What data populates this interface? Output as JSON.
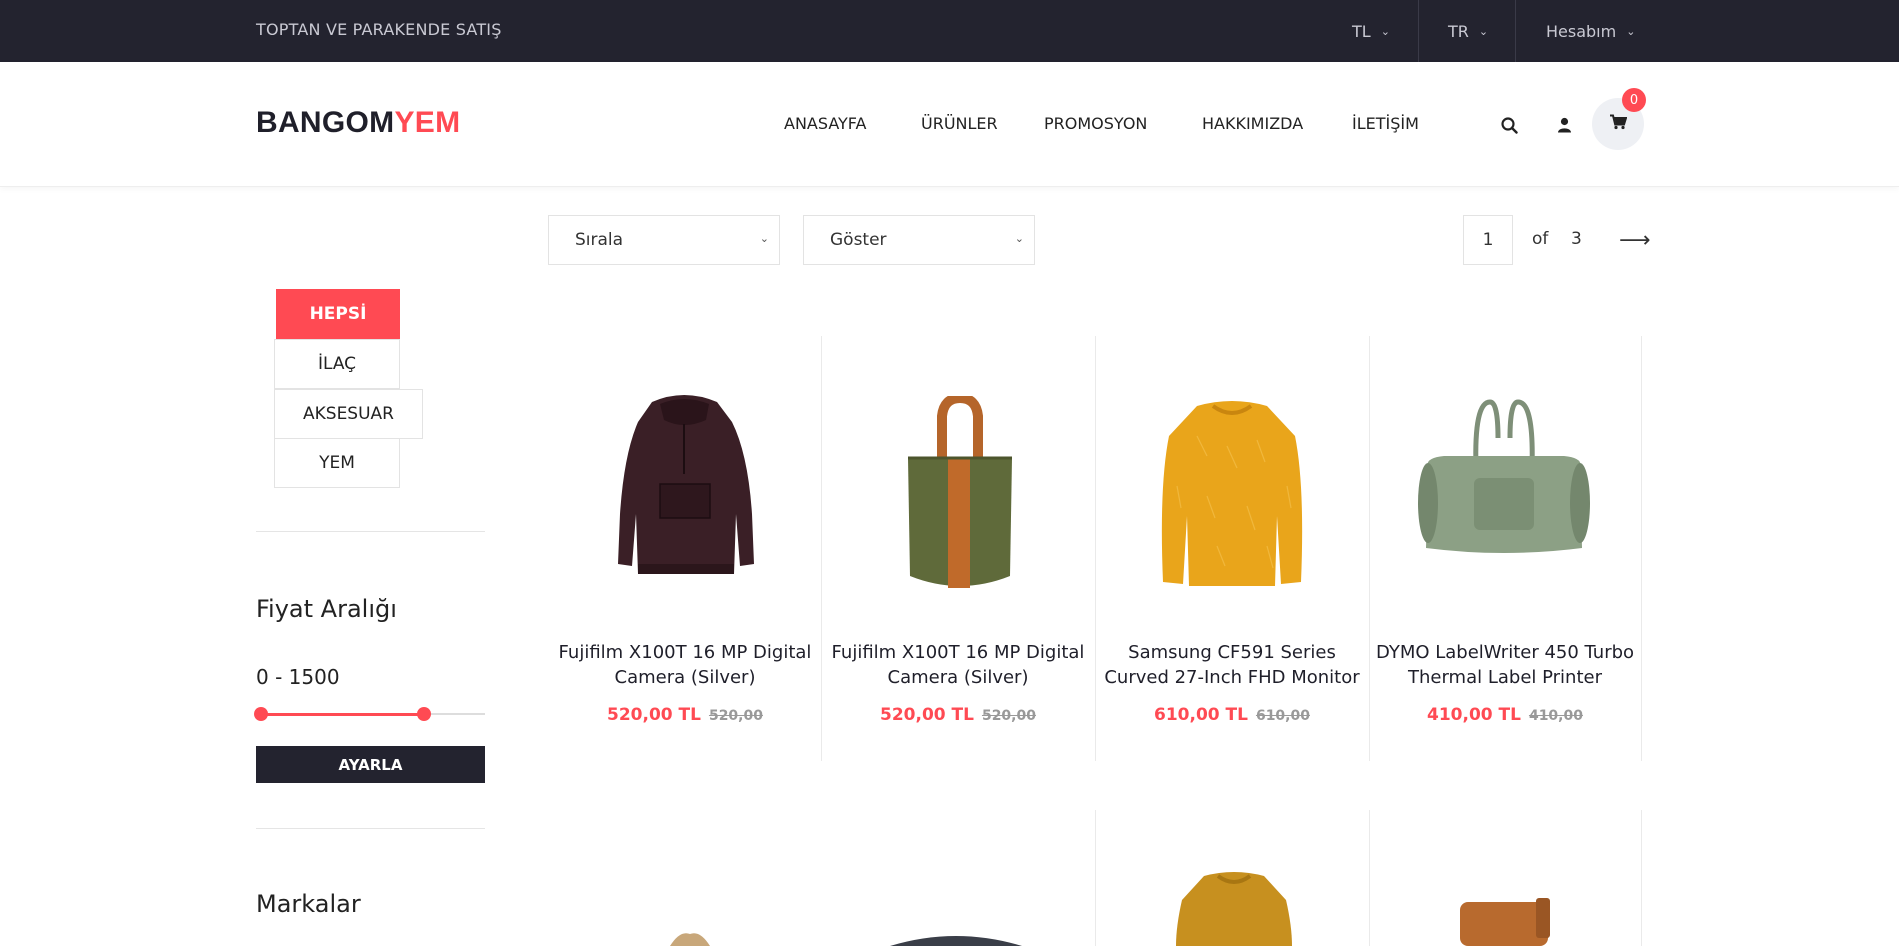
{
  "topbar": {
    "slogan": "TOPTAN VE PARAKENDE SATIŞ",
    "currency": "TL",
    "language": "TR",
    "account": "Hesabım"
  },
  "logo": {
    "part1": "BANGOM",
    "part2": "YEM"
  },
  "nav": [
    "ANASAYFA",
    "ÜRÜNLER",
    "PROMOSYON",
    "HAKKIMIZDA",
    "İLETİŞİM"
  ],
  "cart": {
    "count": "0"
  },
  "toolbar": {
    "sort_label": "Sırala",
    "show_label": "Göster",
    "page_current": "1",
    "page_of": "of",
    "page_total": "3"
  },
  "categories": [
    "HEPSİ",
    "İLAÇ",
    "AKSESUAR",
    "YEM"
  ],
  "price_filter": {
    "title": "Fiyat Aralığı",
    "range": "0 - 1500",
    "apply_label": "AYARLA"
  },
  "brands": {
    "title": "Markalar"
  },
  "products": [
    {
      "name": "Fujifilm X100T 16 MP Digital Camera (Silver)",
      "price": "520,00 TL",
      "old_price": "520,00",
      "image": "hoodie"
    },
    {
      "name": "Fujifilm X100T 16 MP Digital Camera (Silver)",
      "price": "520,00 TL",
      "old_price": "520,00",
      "image": "tote-bag"
    },
    {
      "name": "Samsung CF591 Series Curved 27-Inch FHD Monitor",
      "price": "610,00 TL",
      "old_price": "610,00",
      "image": "sweater"
    },
    {
      "name": "DYMO LabelWriter 450 Turbo Thermal Label Printer",
      "price": "410,00 TL",
      "old_price": "410,00",
      "image": "duffel-bag"
    }
  ],
  "colors": {
    "accent": "#ff4a53",
    "dark": "#23232f"
  }
}
